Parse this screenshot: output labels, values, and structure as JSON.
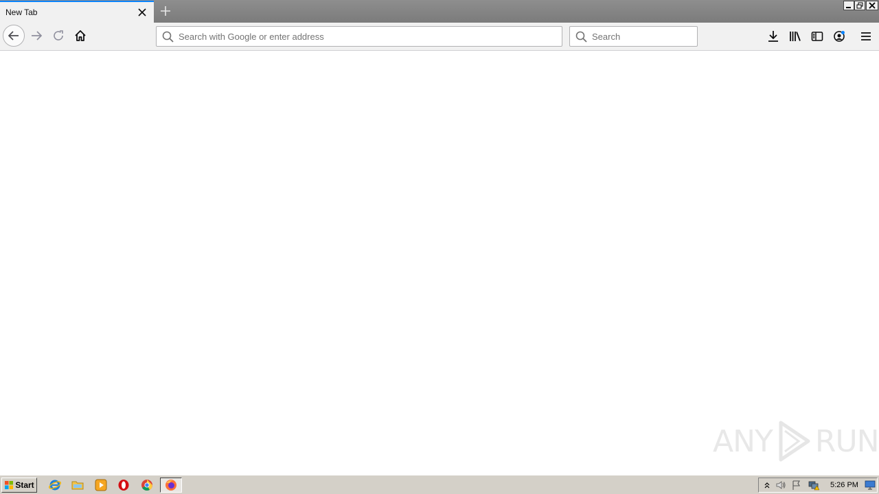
{
  "tab": {
    "title": "New Tab"
  },
  "urlbar": {
    "placeholder": "Search with Google or enter address"
  },
  "searchbar": {
    "placeholder": "Search"
  },
  "watermark": {
    "left": "ANY",
    "right": "RUN"
  },
  "taskbar": {
    "start_label": "Start",
    "clock": "5:26 PM"
  },
  "colors": {
    "accent": "#0a84ff",
    "titlebar": "#8e8e8e",
    "toolbar": "#f1f1f1",
    "taskbar": "#d4d0c8"
  },
  "icons": {
    "toolbar": [
      "back-icon",
      "forward-icon",
      "reload-icon",
      "home-icon",
      "downloads-icon",
      "library-icon",
      "sidebar-icon",
      "account-icon",
      "menu-icon"
    ],
    "taskbar_apps": [
      "internet-explorer-icon",
      "file-explorer-icon",
      "media-player-icon",
      "opera-icon",
      "chrome-icon",
      "firefox-icon"
    ]
  }
}
